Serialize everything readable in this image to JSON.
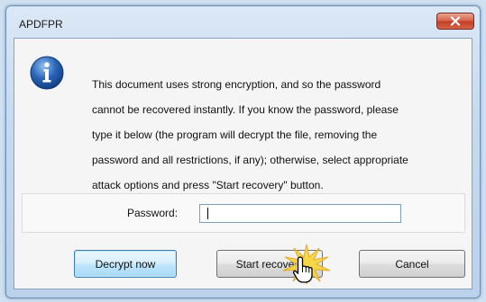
{
  "window": {
    "title": "APDFPR"
  },
  "message": {
    "lines": [
      "This document uses strong encryption, and so the password",
      "cannot be recovered instantly. If you know the password, please",
      "type it below (the program will decrypt the file, removing the",
      "password and all restrictions, if any); otherwise, select appropriate",
      "attack options and press \"Start recovery\" button."
    ]
  },
  "password": {
    "label": "Password:",
    "value": ""
  },
  "buttons": {
    "decrypt": "Decrypt now",
    "start": "Start recovery",
    "cancel": "Cancel"
  },
  "icons": {
    "info": "info-icon",
    "close": "close-icon",
    "cursor": "hand-pointer-icon"
  },
  "colors": {
    "close_button": "#d04a33",
    "info_icon": "#2a64b8",
    "default_button_border": "#3c7fb1"
  }
}
